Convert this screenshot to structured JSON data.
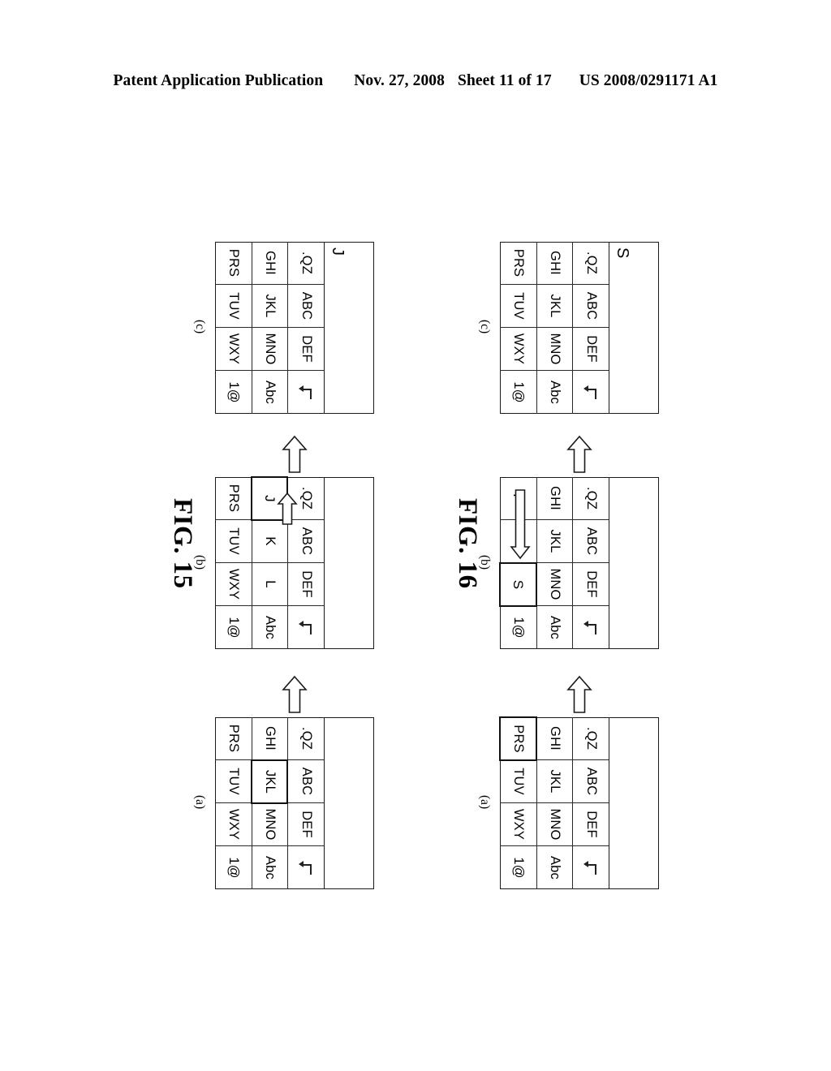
{
  "header": {
    "publication": "Patent Application Publication",
    "date": "Nov. 27, 2008",
    "sheet": "Sheet 11 of 17",
    "patent_number": "US 2008/0291171 A1"
  },
  "figures": [
    {
      "id": "fig15",
      "title": "FIG. 15",
      "panels": [
        {
          "label": "(a)",
          "display": "",
          "keys": [
            {
              "text": ".QZ",
              "selected": false
            },
            {
              "text": "ABC",
              "selected": false
            },
            {
              "text": "DEF",
              "selected": false
            },
            {
              "text": "enter-icon",
              "selected": false
            },
            {
              "text": "GHI",
              "selected": false
            },
            {
              "text": "JKL",
              "selected": true
            },
            {
              "text": "MNO",
              "selected": false
            },
            {
              "text": "Abc",
              "selected": false
            },
            {
              "text": "PRS",
              "selected": false
            },
            {
              "text": "TUV",
              "selected": false
            },
            {
              "text": "WXY",
              "selected": false
            },
            {
              "text": "1@",
              "selected": false
            }
          ],
          "overlay_arrow": null
        },
        {
          "label": "(b)",
          "display": "",
          "keys": [
            {
              "text": ".QZ",
              "selected": false
            },
            {
              "text": "ABC",
              "selected": false
            },
            {
              "text": "DEF",
              "selected": false
            },
            {
              "text": "enter-icon",
              "selected": false
            },
            {
              "text": "J",
              "selected": true
            },
            {
              "text": "K",
              "selected": false
            },
            {
              "text": "L",
              "selected": false
            },
            {
              "text": "Abc",
              "selected": false
            },
            {
              "text": "PRS",
              "selected": false
            },
            {
              "text": "TUV",
              "selected": false
            },
            {
              "text": "WXY",
              "selected": false
            },
            {
              "text": "1@",
              "selected": false
            }
          ],
          "overlay_arrow": {
            "kind": "short-left",
            "from_key": 5,
            "to_key": 4
          }
        },
        {
          "label": "(c)",
          "display": "J",
          "keys": [
            {
              "text": ".QZ",
              "selected": false
            },
            {
              "text": "ABC",
              "selected": false
            },
            {
              "text": "DEF",
              "selected": false
            },
            {
              "text": "enter-icon",
              "selected": false
            },
            {
              "text": "GHI",
              "selected": false
            },
            {
              "text": "JKL",
              "selected": false
            },
            {
              "text": "MNO",
              "selected": false
            },
            {
              "text": "Abc",
              "selected": false
            },
            {
              "text": "PRS",
              "selected": false
            },
            {
              "text": "TUV",
              "selected": false
            },
            {
              "text": "WXY",
              "selected": false
            },
            {
              "text": "1@",
              "selected": false
            }
          ],
          "overlay_arrow": null
        }
      ]
    },
    {
      "id": "fig16",
      "title": "FIG. 16",
      "panels": [
        {
          "label": "(a)",
          "display": "",
          "keys": [
            {
              "text": ".QZ",
              "selected": false
            },
            {
              "text": "ABC",
              "selected": false
            },
            {
              "text": "DEF",
              "selected": false
            },
            {
              "text": "enter-icon",
              "selected": false
            },
            {
              "text": "GHI",
              "selected": false
            },
            {
              "text": "JKL",
              "selected": false
            },
            {
              "text": "MNO",
              "selected": false
            },
            {
              "text": "Abc",
              "selected": false
            },
            {
              "text": "PRS",
              "selected": true
            },
            {
              "text": "TUV",
              "selected": false
            },
            {
              "text": "WXY",
              "selected": false
            },
            {
              "text": "1@",
              "selected": false
            }
          ],
          "overlay_arrow": null
        },
        {
          "label": "(b)",
          "display": "",
          "keys": [
            {
              "text": ".QZ",
              "selected": false
            },
            {
              "text": "ABC",
              "selected": false
            },
            {
              "text": "DEF",
              "selected": false
            },
            {
              "text": "enter-icon",
              "selected": false
            },
            {
              "text": "GHI",
              "selected": false
            },
            {
              "text": "JKL",
              "selected": false
            },
            {
              "text": "MNO",
              "selected": false
            },
            {
              "text": "Abc",
              "selected": false
            },
            {
              "text": "P",
              "selected": false
            },
            {
              "text": "",
              "selected": false
            },
            {
              "text": "S",
              "selected": true
            },
            {
              "text": "1@",
              "selected": false
            }
          ],
          "overlay_arrow": {
            "kind": "long-right",
            "from_key": 8,
            "to_key": 10
          }
        },
        {
          "label": "(c)",
          "display": "S",
          "keys": [
            {
              "text": ".QZ",
              "selected": false
            },
            {
              "text": "ABC",
              "selected": false
            },
            {
              "text": "DEF",
              "selected": false
            },
            {
              "text": "enter-icon",
              "selected": false
            },
            {
              "text": "GHI",
              "selected": false
            },
            {
              "text": "JKL",
              "selected": false
            },
            {
              "text": "MNO",
              "selected": false
            },
            {
              "text": "Abc",
              "selected": false
            },
            {
              "text": "PRS",
              "selected": false
            },
            {
              "text": "TUV",
              "selected": false
            },
            {
              "text": "WXY",
              "selected": false
            },
            {
              "text": "1@",
              "selected": false
            }
          ],
          "overlay_arrow": null
        }
      ]
    }
  ],
  "colors": {
    "ink": "#111111",
    "grid_line": "#2a2a2a",
    "paper": "#ffffff"
  }
}
